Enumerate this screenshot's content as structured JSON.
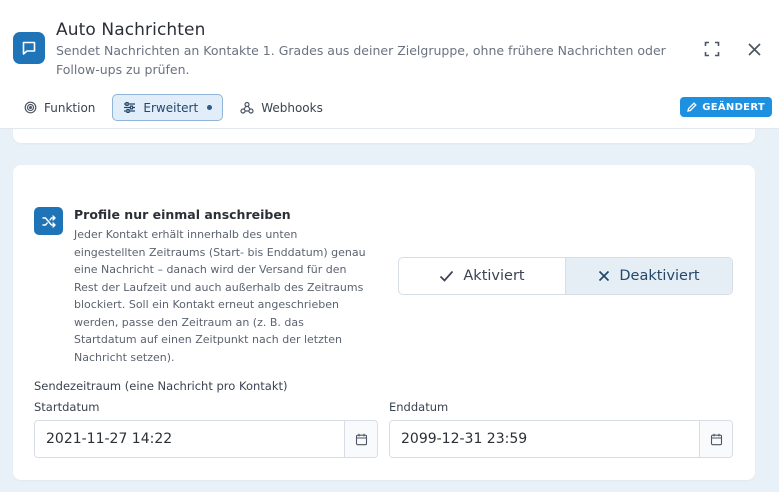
{
  "header": {
    "title": "Auto Nachrichten",
    "subtitle": "Sendet Nachrichten an Kontakte 1. Grades aus deiner Zielgruppe, ohne frühere Nachrichten oder Follow-ups zu prüfen.",
    "app_icon": "message-square-icon",
    "expand_icon": "maximize-icon",
    "close_icon": "close-icon"
  },
  "tabs": [
    {
      "label": "Funktion",
      "icon": "target-icon",
      "active": false
    },
    {
      "label": "Erweitert",
      "icon": "sliders-icon",
      "active": true
    },
    {
      "label": "Webhooks",
      "icon": "webhook-icon",
      "active": false
    }
  ],
  "status_badge": {
    "label": "GEÄNDERT",
    "icon": "pencil-icon",
    "color": "#1e90e0"
  },
  "section": {
    "icon": "shuffle-icon",
    "title": "Profile nur einmal anschreiben",
    "description": "Jeder Kontakt erhält innerhalb des unten eingestellten Zeitraums (Start- bis Enddatum) genau eine Nachricht – danach wird der Versand für den Rest der Laufzeit und auch außerhalb des Zeitraums blockiert. Soll ein Kontakt erneut angeschrieben werden, passe den Zeitraum an (z. B. das Startdatum auf einen Zeitpunkt nach der letzten Nachricht setzen).",
    "toggle": {
      "options": [
        {
          "label": "Aktiviert",
          "icon": "check-icon"
        },
        {
          "label": "Deaktiviert",
          "icon": "x-icon"
        }
      ],
      "selected": "Deaktiviert"
    }
  },
  "period": {
    "label": "Sendezeitraum (eine Nachricht pro Kontakt)",
    "start": {
      "label": "Startdatum",
      "value": "2021-11-27 14:22",
      "icon": "calendar-icon"
    },
    "end": {
      "label": "Enddatum",
      "value": "2099-12-31 23:59",
      "icon": "calendar-icon"
    }
  },
  "colors": {
    "accent": "#1f74b8",
    "badge": "#1e90e0",
    "background": "#e9f1f8"
  }
}
